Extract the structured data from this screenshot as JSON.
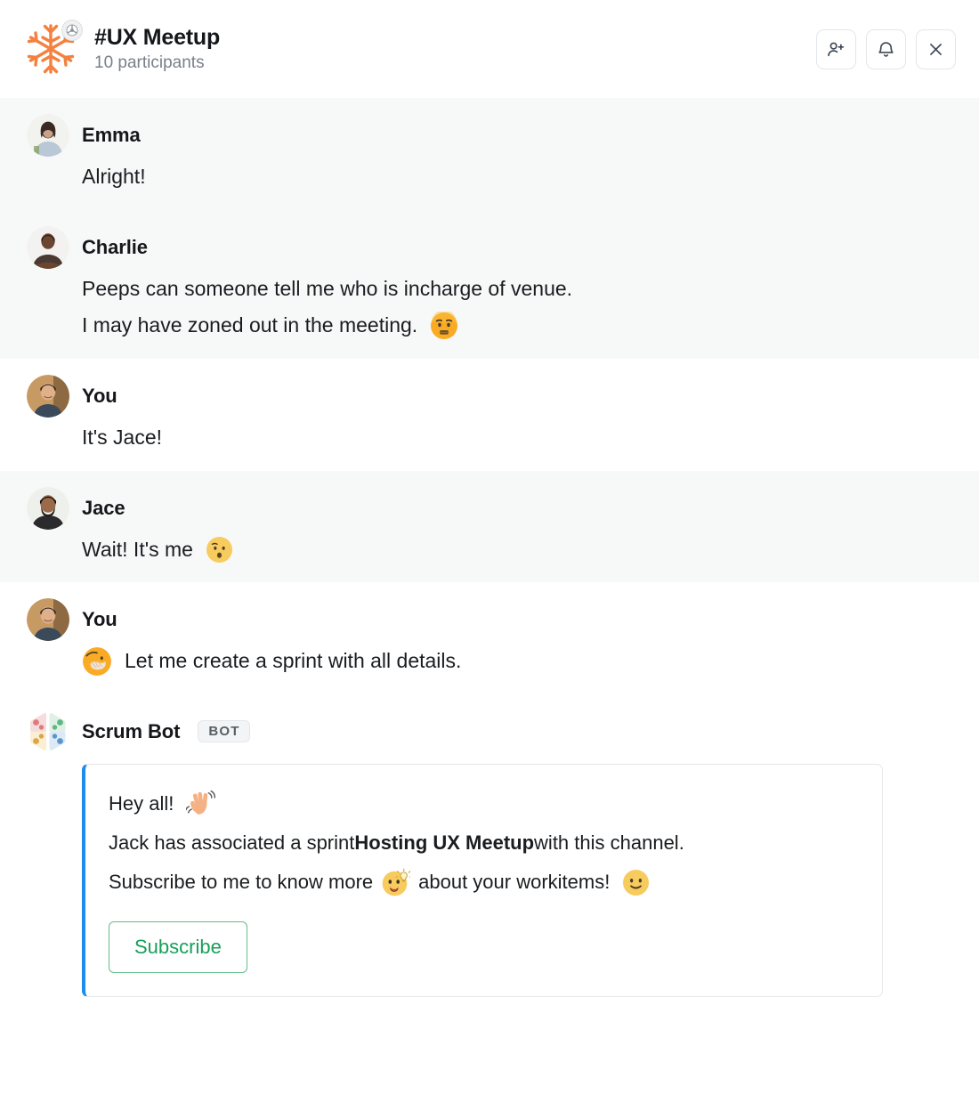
{
  "header": {
    "channel_icon": "snowflake-icon",
    "channel_badge_icon": "activity-badge-icon",
    "title": "#UX Meetup",
    "participants": "10 participants",
    "actions": [
      {
        "name": "add-person-button",
        "icon": "add-person-icon"
      },
      {
        "name": "notifications-button",
        "icon": "bell-icon"
      },
      {
        "name": "close-button",
        "icon": "close-icon"
      }
    ]
  },
  "messages": [
    {
      "author": "Emma",
      "avatar": "emma-avatar",
      "shaded": true,
      "lines": [
        {
          "text": "Alright!"
        }
      ]
    },
    {
      "author": "Charlie",
      "avatar": "charlie-avatar",
      "shaded": true,
      "lines": [
        {
          "text": "Peeps can someone tell me who is incharge of venue."
        },
        {
          "text": "I may have zoned out in the meeting.",
          "trailing_emoji": "worried-face-emoji"
        }
      ]
    },
    {
      "author": "You",
      "avatar": "you-avatar",
      "shaded": false,
      "lines": [
        {
          "text": "It's Jace!"
        }
      ]
    },
    {
      "author": "Jace",
      "avatar": "jace-avatar",
      "shaded": true,
      "lines": [
        {
          "text": "Wait! It's me",
          "trailing_emoji": "surprised-face-emoji"
        }
      ]
    },
    {
      "author": "You",
      "avatar": "you-avatar",
      "shaded": false,
      "lines": [
        {
          "text": "Let me create a sprint with all details.",
          "leading_emoji": "hand-over-mouth-emoji"
        }
      ]
    }
  ],
  "bot_message": {
    "author": "Scrum Bot",
    "avatar": "scrum-bot-avatar",
    "badge": "BOT",
    "card": {
      "line1_text": "Hey all!",
      "line1_emoji": "waving-hand-emoji",
      "line2_prefix": "Jack has associated a sprint ",
      "line2_strong": "Hosting UX Meetup",
      "line2_suffix": " with this channel.",
      "line3_prefix": "Subscribe to me to know more",
      "line3_emoji": "face-with-lightbulb-emoji",
      "line3_mid": "about your workitems!",
      "line3_emoji2": "slight-smile-emoji",
      "subscribe_label": "Subscribe"
    }
  },
  "colors": {
    "accent_blue": "#1b8cf0",
    "subscribe_green": "#16a05a",
    "snowflake_orange": "#f4813f",
    "shaded_row": "#f7f9f9",
    "text_primary": "#15171a",
    "text_secondary": "#7a8088"
  }
}
